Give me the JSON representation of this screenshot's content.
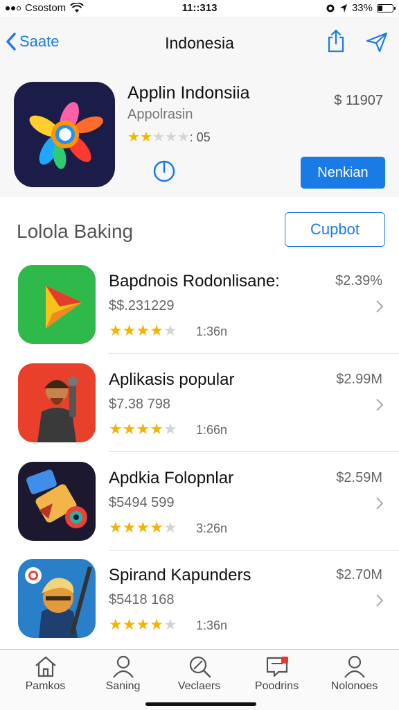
{
  "status": {
    "carrier": "Csostom",
    "time": "11::313",
    "battery": "33%",
    "battery_level": 0.33
  },
  "nav": {
    "back_label": "Saate",
    "title": "Indonesia"
  },
  "hero": {
    "name": "Applin Indonsiia",
    "subtitle": "Appolrasin",
    "rating_text": ": 05",
    "rating_stars": 2,
    "price": "$ 11907",
    "get_label": "Nenkian"
  },
  "section": {
    "title": "Lolola Baking",
    "button_label": "Cupbot"
  },
  "apps": [
    {
      "name": "Bapdnois Rodonlisane:",
      "price": "$2.39%",
      "sub": "$$.231229",
      "rating": 3.5,
      "count": "1:36n"
    },
    {
      "name": "Aplikasis popular",
      "price": "$2.99M",
      "sub": "$7.38 798",
      "rating": 3.5,
      "count": "1:66n"
    },
    {
      "name": "Apdkia Folopnlar",
      "price": "$2.59M",
      "sub": "$5494 599",
      "rating": 4,
      "count": "3:26n"
    },
    {
      "name": "Spirand Kapunders",
      "price": "$2.70M",
      "sub": "$5418 168",
      "rating": 3.5,
      "count": "1:36n"
    }
  ],
  "tabs": [
    {
      "label": "Pamkos",
      "icon": "home-icon"
    },
    {
      "label": "Saning",
      "icon": "person-icon"
    },
    {
      "label": "Veclaers",
      "icon": "search-icon"
    },
    {
      "label": "Poodrins",
      "icon": "message-icon"
    },
    {
      "label": "Nolonoes",
      "icon": "profile-icon"
    }
  ]
}
